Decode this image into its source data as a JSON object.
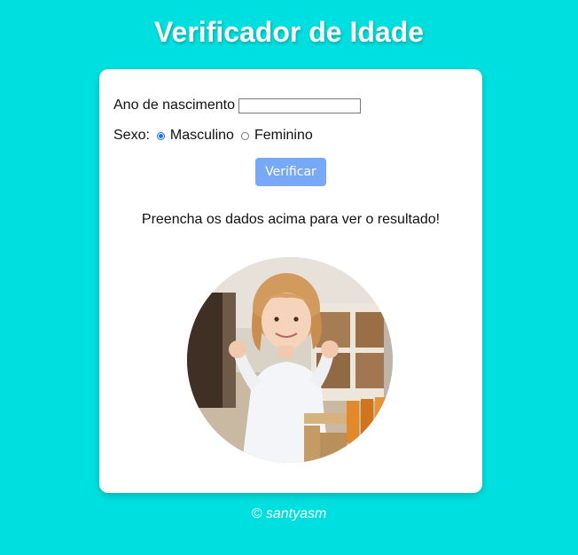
{
  "page": {
    "title": "Verificador de Idade",
    "background_color": "#00dfe0"
  },
  "form": {
    "birth_year_label": "Ano de nascimento",
    "birth_year_value": "",
    "sex_label": "Sexo:",
    "sex_options": [
      {
        "label": "Masculino",
        "selected": true
      },
      {
        "label": "Feminino",
        "selected": false
      }
    ],
    "verify_button_label": "Verificar",
    "button_color": "#78a9f8"
  },
  "result": {
    "message": "Preencha os dados acima para ver o resultado!",
    "image_icon": "child-photo"
  },
  "footer": {
    "text": "© santyasm"
  }
}
